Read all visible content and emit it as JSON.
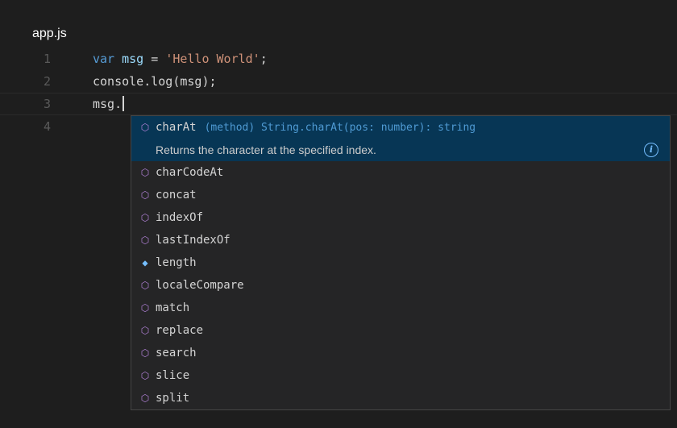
{
  "file": {
    "title": "app.js"
  },
  "editor": {
    "lines": [
      {
        "number": "1",
        "tokens": [
          {
            "type": "kw",
            "text": "var"
          },
          {
            "type": "op",
            "text": " "
          },
          {
            "type": "var",
            "text": "msg"
          },
          {
            "type": "op",
            "text": " = "
          },
          {
            "type": "str",
            "text": "'Hello World'"
          },
          {
            "type": "op",
            "text": ";"
          }
        ]
      },
      {
        "number": "2",
        "tokens": [
          {
            "type": "op",
            "text": "console.log(msg);"
          }
        ]
      },
      {
        "number": "3",
        "tokens": [
          {
            "type": "op",
            "text": "msg."
          }
        ]
      },
      {
        "number": "4",
        "tokens": []
      }
    ]
  },
  "suggest": {
    "selected": {
      "label": "charAt",
      "detail": "(method) String.charAt(pos: number): string",
      "doc": "Returns the character at the specified index.",
      "icon": "method-icon"
    },
    "items": [
      {
        "label": "charCodeAt",
        "kind": "method"
      },
      {
        "label": "concat",
        "kind": "method"
      },
      {
        "label": "indexOf",
        "kind": "method"
      },
      {
        "label": "lastIndexOf",
        "kind": "method"
      },
      {
        "label": "length",
        "kind": "property"
      },
      {
        "label": "localeCompare",
        "kind": "method"
      },
      {
        "label": "match",
        "kind": "method"
      },
      {
        "label": "replace",
        "kind": "method"
      },
      {
        "label": "search",
        "kind": "method"
      },
      {
        "label": "slice",
        "kind": "method"
      },
      {
        "label": "split",
        "kind": "method"
      }
    ]
  },
  "colors": {
    "background": "#1e1e1e",
    "keyword": "#569cd6",
    "variable": "#9cdcfe",
    "string": "#ce9178",
    "method_icon": "#b180d7",
    "property_icon": "#75beff",
    "selection": "#073655"
  }
}
